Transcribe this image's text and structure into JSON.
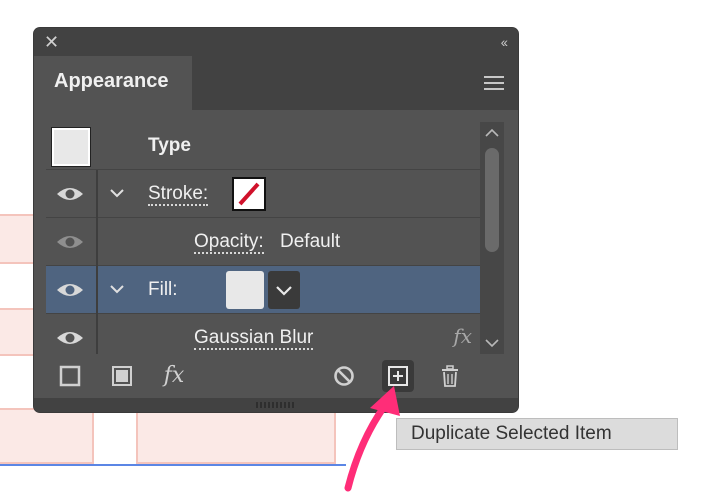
{
  "panel": {
    "title": "Appearance",
    "collapse_glyph": "‹‹",
    "close_glyph": "✕"
  },
  "rows": [
    {
      "label": "Type"
    },
    {
      "label": "Stroke:"
    },
    {
      "label": "Opacity:",
      "value": "Default"
    },
    {
      "label": "Fill:"
    },
    {
      "label": "Gaussian Blur"
    }
  ],
  "toolbar": {
    "fx_label": "fx"
  },
  "tooltip": {
    "text": "Duplicate Selected Item"
  },
  "colors": {
    "panel_bg": "#535353",
    "selected_row": "#4f6480",
    "arrow": "#ff2d78",
    "stroke_swatch_slash": "#d0112b"
  },
  "icons": [
    "close-icon",
    "collapse-icon",
    "panel-menu-icon",
    "eye-icon",
    "chevron-down-icon",
    "fx-icon",
    "add-new-stroke-icon",
    "add-new-fill-icon",
    "add-new-effect-icon",
    "clear-appearance-icon",
    "duplicate-item-icon",
    "delete-item-icon",
    "scroll-up-icon",
    "scroll-down-icon"
  ]
}
